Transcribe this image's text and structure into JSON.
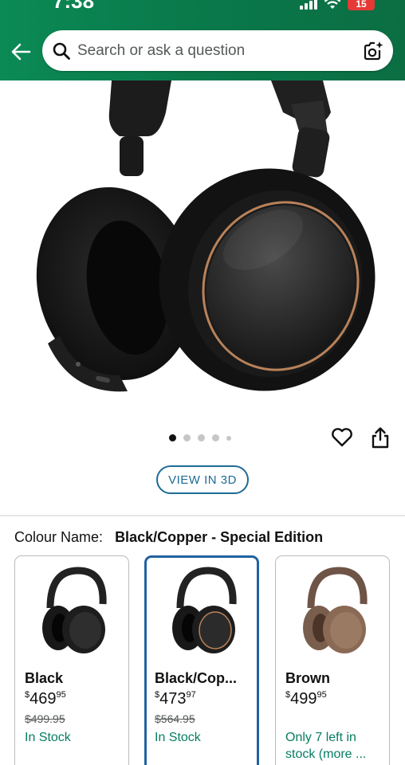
{
  "status": {
    "time": "7:38",
    "battery": "15"
  },
  "search": {
    "placeholder": "Search or ask a question"
  },
  "gallery": {
    "image_count": 5,
    "active_index": 0
  },
  "view3d": {
    "label": "VIEW IN 3D"
  },
  "colour": {
    "label": "Colour Name:",
    "value": "Black/Copper - Special Edition"
  },
  "swatches": [
    {
      "name": "Black",
      "currency": "$",
      "price_whole": "469",
      "price_fraction": "95",
      "old_price": "$499.95",
      "stock": "In Stock",
      "color": "#1b1b1b",
      "selected": false
    },
    {
      "name": "Black/Cop...",
      "currency": "$",
      "price_whole": "473",
      "price_fraction": "97",
      "old_price": "$564.95",
      "stock": "In Stock",
      "color": "#1b1b1b",
      "selected": true
    },
    {
      "name": "Brown",
      "currency": "$",
      "price_whole": "499",
      "price_fraction": "95",
      "old_price": "",
      "stock": "Only 7 left in stock (more ...",
      "color": "#8a6a55",
      "selected": false
    }
  ],
  "colors": {
    "header": "#0a7a4b",
    "accent_blue": "#2162a1",
    "stock_green": "#067d62"
  },
  "icons": [
    "back-arrow-icon",
    "search-icon",
    "camera-lens-icon",
    "heart-icon",
    "share-icon"
  ]
}
